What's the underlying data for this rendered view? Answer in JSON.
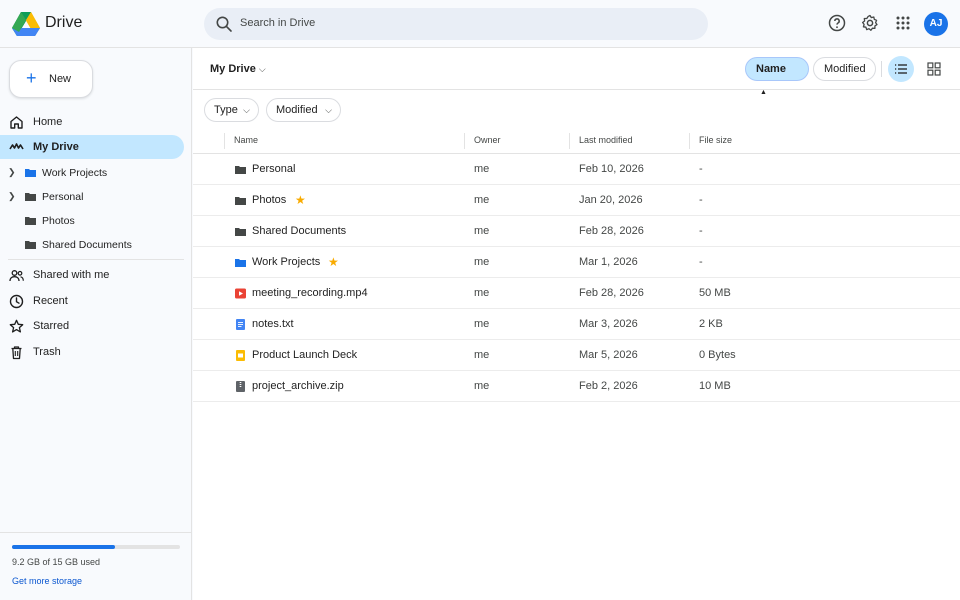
{
  "app": {
    "name": "Drive"
  },
  "search": {
    "placeholder": "Search in Drive"
  },
  "user": {
    "initials": "AJ"
  },
  "sidebar": {
    "new_label": "New",
    "nav": [
      {
        "label": "Home",
        "icon": "home-icon"
      },
      {
        "label": "My Drive",
        "icon": "drive-icon",
        "active": true
      }
    ],
    "tree": [
      {
        "label": "Work Projects",
        "expandable": true
      },
      {
        "label": "Personal",
        "expandable": true
      },
      {
        "label": "Photos",
        "expandable": false
      },
      {
        "label": "Shared Documents",
        "expandable": false
      }
    ],
    "nav2": [
      {
        "label": "Shared with me",
        "icon": "people-icon"
      },
      {
        "label": "Recent",
        "icon": "clock-icon"
      },
      {
        "label": "Starred",
        "icon": "star-icon"
      },
      {
        "label": "Trash",
        "icon": "trash-icon"
      }
    ],
    "storage": {
      "text": "9.2 GB of 15 GB used",
      "used_fraction": 0.613,
      "link": "Get more storage"
    }
  },
  "main": {
    "breadcrumb": "My Drive",
    "sort": {
      "active": "Name",
      "arrow": "▲",
      "other": "Modified"
    },
    "filters": [
      "Type",
      "Modified"
    ],
    "columns": {
      "name": "Name",
      "owner": "Owner",
      "modified": "Last modified",
      "size": "File size"
    },
    "files": [
      {
        "name": "Personal",
        "type": "folder",
        "owner": "me",
        "modified": "Feb 10, 2026",
        "size": "-",
        "starred": false
      },
      {
        "name": "Photos",
        "type": "folder",
        "owner": "me",
        "modified": "Jan 20, 2026",
        "size": "-",
        "starred": true
      },
      {
        "name": "Shared Documents",
        "type": "folder",
        "owner": "me",
        "modified": "Feb 28, 2026",
        "size": "-",
        "starred": false
      },
      {
        "name": "Work Projects",
        "type": "folder-blue",
        "owner": "me",
        "modified": "Mar 1, 2026",
        "size": "-",
        "starred": true
      },
      {
        "name": "meeting_recording.mp4",
        "type": "video",
        "owner": "me",
        "modified": "Feb 28, 2026",
        "size": "50 MB",
        "starred": false
      },
      {
        "name": "notes.txt",
        "type": "doc",
        "owner": "me",
        "modified": "Mar 3, 2026",
        "size": "2 KB",
        "starred": false
      },
      {
        "name": "Product Launch Deck",
        "type": "slides",
        "owner": "me",
        "modified": "Mar 5, 2026",
        "size": "0 Bytes",
        "starred": false
      },
      {
        "name": "project_archive.zip",
        "type": "archive",
        "owner": "me",
        "modified": "Feb 2, 2026",
        "size": "10 MB",
        "starred": false
      }
    ]
  },
  "colors": {
    "accent": "#1a73e8",
    "active_bg": "#c2e7ff",
    "star": "#f9ab00"
  }
}
